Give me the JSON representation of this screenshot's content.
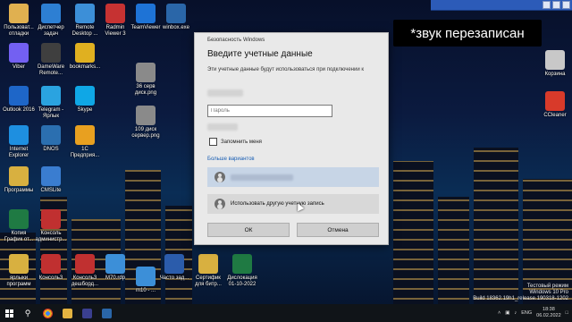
{
  "desktop_icons": [
    {
      "label": "Пользоват... отладки",
      "icon": "user-folder-icon",
      "color": "#e0b050"
    },
    {
      "label": "Диспетчер задач",
      "icon": "task-manager-icon",
      "color": "#2d7fd3"
    },
    {
      "label": "Remote Desktop ...",
      "icon": "remote-desktop-icon",
      "color": "#3c8fd8"
    },
    {
      "label": "Radmin Viewer 3",
      "icon": "radmin-icon",
      "color": "#c63232"
    },
    {
      "label": "TeamViewer",
      "icon": "teamviewer-icon",
      "color": "#1e73d6"
    },
    {
      "label": "winbox.exe",
      "icon": "winbox-icon",
      "color": "#2a66a8"
    },
    {
      "label": "Viber",
      "icon": "viber-icon",
      "color": "#7360f2"
    },
    {
      "label": "DameWare Remote...",
      "icon": "dameware-icon",
      "color": "#3f3f3f"
    },
    {
      "label": "bookmarks...",
      "icon": "chrome-icon",
      "color": "#e0b020"
    },
    {
      "label": "36 серв диск.png",
      "icon": "image-file-icon",
      "color": "#8a8a8a"
    },
    {
      "label": "Outlook 2016",
      "icon": "outlook-icon",
      "color": "#1e66c8"
    },
    {
      "label": "Telegram - Ярлык",
      "icon": "telegram-icon",
      "color": "#2aa3e0"
    },
    {
      "label": "Skype",
      "icon": "skype-icon",
      "color": "#0fa7e6"
    },
    {
      "label": "109 диск сервер.png",
      "icon": "image-file-icon",
      "color": "#8a8a8a"
    },
    {
      "label": "Internet Explorer",
      "icon": "ie-icon",
      "color": "#1e8fe0"
    },
    {
      "label": "DNOS",
      "icon": "dnos-icon",
      "color": "#2b6fb0"
    },
    {
      "label": "1С Предприя...",
      "icon": "1c-icon",
      "color": "#e8a020"
    },
    {
      "label": "Программы",
      "icon": "programs-folder-icon",
      "color": "#d8b040"
    },
    {
      "label": "CMSLite",
      "icon": "cms-icon",
      "color": "#3a7dd0"
    },
    {
      "label": "Копия График от...",
      "icon": "excel-icon",
      "color": "#1f7a43"
    },
    {
      "label": "Консоль администр...",
      "icon": "console-icon",
      "color": "#c03030"
    },
    {
      "label": "ярлыки программ",
      "icon": "shortcuts-folder-icon",
      "color": "#d8b040"
    },
    {
      "label": "Консоль3",
      "icon": "console-icon",
      "color": "#c03030"
    },
    {
      "label": "Консоль3 дешборд...",
      "icon": "console-icon",
      "color": "#c03030"
    },
    {
      "label": "М70.rdp",
      "icon": "rdp-file-icon",
      "color": "#3c8fd8"
    },
    {
      "label": "m10 - ...",
      "icon": "rdp-file-icon",
      "color": "#3c8fd8"
    },
    {
      "label": "Часто зад...",
      "icon": "word-icon",
      "color": "#2b5cab"
    },
    {
      "label": "Сертифик для битр...",
      "icon": "folder-icon",
      "color": "#d8b040"
    },
    {
      "label": "Дислокация 01-10-2022",
      "icon": "excel-icon",
      "color": "#1f7a43"
    },
    {
      "label": "Корзина",
      "icon": "recycle-bin-icon",
      "color": "#c8c8c8"
    },
    {
      "label": "CCleaner",
      "icon": "ccleaner-icon",
      "color": "#d83a2a"
    }
  ],
  "caption_text": "*звук перезаписан",
  "dialog": {
    "title": "Безопасность Windows",
    "heading": "Введите учетные данные",
    "description": "Эти учетные данные будут использоваться при подключении к",
    "password_placeholder": "Пароль",
    "remember_label": "Запомнить меня",
    "more_options": "Больше вариантов",
    "other_account": "Использовать другую учетную запись",
    "ok_label": "ОК",
    "cancel_label": "Отмена"
  },
  "watermark": {
    "line1": "Тестовый режим",
    "line2": "Windows 10 Pro",
    "line3": "Build 18362.19h1_release.190318-1202"
  },
  "tray": {
    "lang": "ENG",
    "time": "18:38",
    "date": "06.02.2022"
  }
}
